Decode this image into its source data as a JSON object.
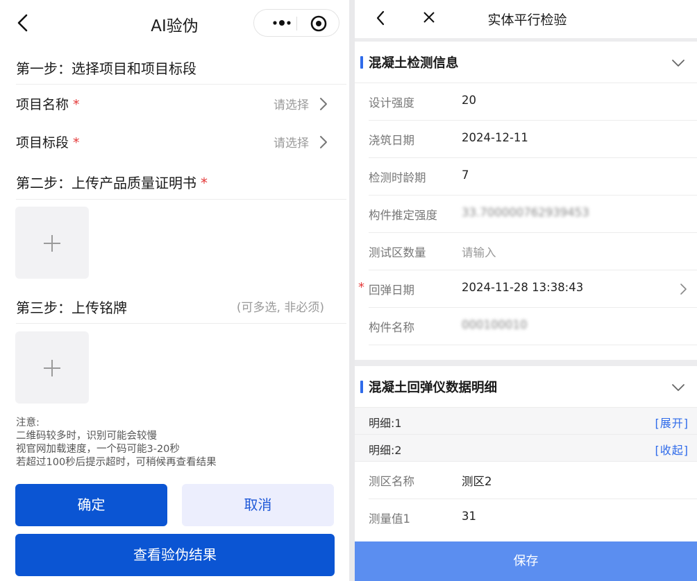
{
  "left": {
    "title": "AI验伪",
    "step1": "第一步：选择项目和项目标段",
    "fields": [
      {
        "label": "项目名称",
        "placeholder": "请选择"
      },
      {
        "label": "项目标段",
        "placeholder": "请选择"
      }
    ],
    "required_mark": "*",
    "step2": "第二步：上传产品质量证明书",
    "step3": "第三步：上传铭牌",
    "step3_hint": "(可多选, 非必须)",
    "notes": [
      "注意:",
      "二维码较多时，识别可能会较慢",
      "视官网加载速度，一个码可能3-20秒",
      "若超过100秒后提示超时，可稍候再查看结果"
    ],
    "confirm_label": "确定",
    "cancel_label": "取消",
    "view_result_label": "查看验伪结果"
  },
  "right": {
    "title": "实体平行检验",
    "section1_title": "混凝土检测信息",
    "fields": [
      {
        "label": "设计强度",
        "value": "20"
      },
      {
        "label": "浇筑日期",
        "value": "2024-12-11"
      },
      {
        "label": "检测时龄期",
        "value": "7"
      },
      {
        "label": "构件推定强度",
        "value": "33.700000762939453"
      },
      {
        "label": "测试区数量",
        "value": "请输入"
      },
      {
        "label": "回弹日期",
        "value": "2024-11-28 13:38:43"
      },
      {
        "label": "构件名称",
        "value": "000100010"
      }
    ],
    "required_mark": "*",
    "section2_title": "混凝土回弹仪数据明细",
    "details": [
      {
        "label": "明细:1",
        "action": "[展开]"
      },
      {
        "label": "明细:2",
        "action": "[收起]"
      }
    ],
    "detail_fields": [
      {
        "label": "测区名称",
        "value": "测区2"
      },
      {
        "label": "测量值1",
        "value": "31"
      }
    ],
    "save_label": "保存"
  },
  "colors": {
    "primary": "#0b55d3",
    "secondary_bg": "#eceefd",
    "accent": "#2f6bea",
    "save_bg": "#5b8ef0",
    "required": "#e43a3a"
  }
}
